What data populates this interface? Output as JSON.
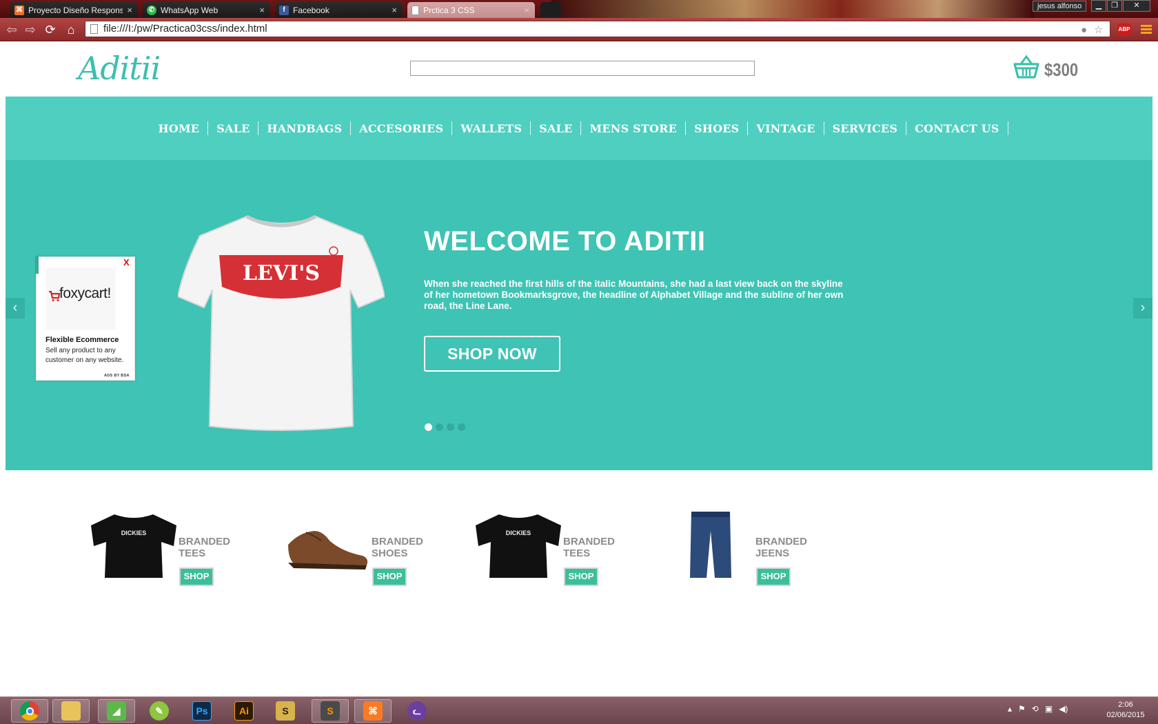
{
  "browser": {
    "tabs": [
      {
        "title": "Proyecto Diseño Responsi",
        "favicon": "xampp-icon",
        "color": "#e8722a"
      },
      {
        "title": "WhatsApp Web",
        "favicon": "whatsapp-icon",
        "color": "#2fb84b"
      },
      {
        "title": "Facebook",
        "favicon": "facebook-icon",
        "color": "#3b5998"
      },
      {
        "title": "Prctica 3 CSS",
        "favicon": "page-icon",
        "color": "#ffffff"
      }
    ],
    "tab_close": "×",
    "user": "jesus alfonso",
    "url": "file:///I:/pw/Practica03css/index.html",
    "abp_label": "ABP"
  },
  "site": {
    "logo": "Aditii",
    "search_value": "",
    "cart_total": "$300",
    "nav": [
      "HOME",
      "SALE",
      "HANDBAGS",
      "ACCESORIES",
      "WALLETS",
      "SALE",
      "MENS STORE",
      "SHOES",
      "VINTAGE",
      "SERVICES",
      "CONTACT US"
    ],
    "hero": {
      "title": "WELCOME TO ADITII",
      "text": "When she reached the first hills of the italic Mountains, she had a last view back on the skyline of her hometown Bookmarksgrove, the headline of Alphabet Village and the subline of her own road, the Line Lane.",
      "button": "SHOP NOW",
      "prev": "‹",
      "next": "›",
      "slides": 4,
      "active_slide": 1,
      "shirt_logo": "LEVI'S"
    },
    "ad": {
      "close": "X",
      "brand": "foxycart!",
      "heading": "Flexible Ecommerce",
      "body": "Sell any product to any customer on any website.",
      "by": "ADS BY BSA"
    },
    "products": [
      {
        "line1": "BRANDED",
        "line2": "TEES",
        "button": "SHOP",
        "image": "black-tee-dickies",
        "print": "DICKIES"
      },
      {
        "line1": "BRANDED",
        "line2": "SHOES",
        "button": "SHOP",
        "image": "brown-leather-shoes"
      },
      {
        "line1": "BRANDED",
        "line2": "TEES",
        "button": "SHOP",
        "image": "black-tee-dickies",
        "print": "DICKIES"
      },
      {
        "line1": "BRANDED",
        "line2": "JEENS",
        "button": "SHOP",
        "image": "blue-jeans"
      }
    ]
  },
  "taskbar": {
    "apps": [
      "chrome-icon",
      "file-explorer-icon",
      "camtasia-icon",
      "corel-icon",
      "photoshop-icon",
      "illustrator-icon",
      "sql-icon",
      "sublime-text-icon",
      "xampp-icon",
      "cat-icon"
    ],
    "ps_label": "Ps",
    "ai_label": "Ai",
    "time": "2:06",
    "date": "02/06/2015"
  },
  "colors": {
    "accent": "#3fc3b4",
    "nav_bg": "#4fcfc0",
    "shop_button": "#3bbf9a"
  }
}
